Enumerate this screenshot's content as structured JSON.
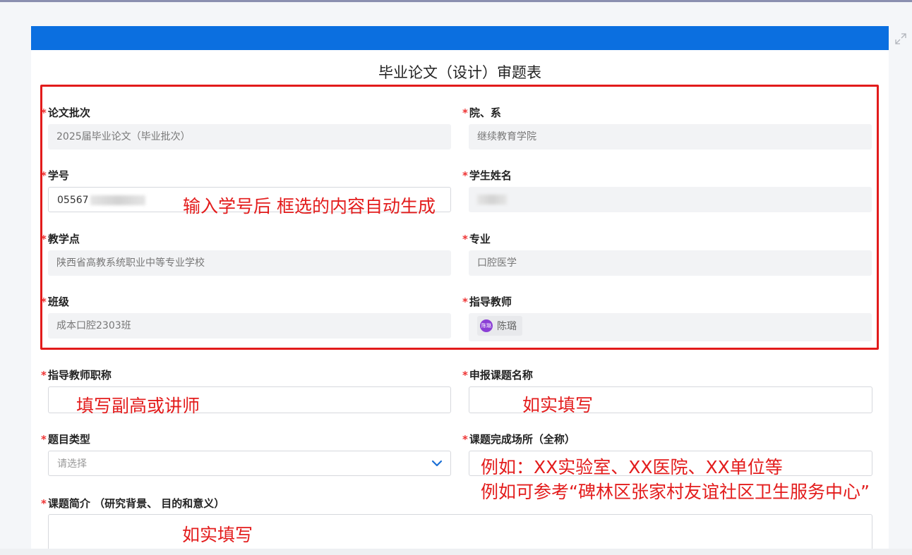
{
  "form": {
    "title": "毕业论文（设计）审题表",
    "required_mark": "*",
    "fields": {
      "batch": {
        "label": "论文批次",
        "value": "2025届毕业论文（毕业批次）"
      },
      "department": {
        "label": "院、系",
        "value": "继续教育学院"
      },
      "student_id": {
        "label": "学号",
        "value": "05567"
      },
      "student_name": {
        "label": "学生姓名",
        "value": ""
      },
      "teaching_site": {
        "label": "教学点",
        "value": "陕西省高教系统职业中等专业学校"
      },
      "major": {
        "label": "专业",
        "value": "口腔医学"
      },
      "class": {
        "label": "班级",
        "value": "成本口腔2303班"
      },
      "advisor": {
        "label": "指导教师",
        "value": "陈璐",
        "avatar_text": "陈璐"
      },
      "advisor_title": {
        "label": "指导教师职称",
        "value": ""
      },
      "topic_name": {
        "label": "申报课题名称",
        "value": ""
      },
      "topic_type": {
        "label": "题目类型",
        "placeholder": "请选择"
      },
      "venue": {
        "label": "课题完成场所（全称）",
        "value": ""
      },
      "summary": {
        "label": "课题简介 （研究背景、 目的和意义）",
        "value": ""
      }
    }
  },
  "annotations": {
    "auto_fill": "输入学号后  框选的内容自动生成",
    "advisor_title_hint": "填写副高或讲师",
    "topic_name_hint": "如实填写",
    "venue_hint_1": "例如：XX实验室、XX医院、XX单位等",
    "venue_hint_2": "例如可参考“碑林区张家村友谊社区卫生服务中心”",
    "summary_hint": "如实填写"
  },
  "colors": {
    "header_blue": "#0b6fe0",
    "annotation_red": "#e31c1c",
    "required_red": "#e33333",
    "avatar_purple": "#8b3fd6"
  },
  "icons": {
    "expand": "expand-icon",
    "dropdown": "chevron-down-icon"
  }
}
